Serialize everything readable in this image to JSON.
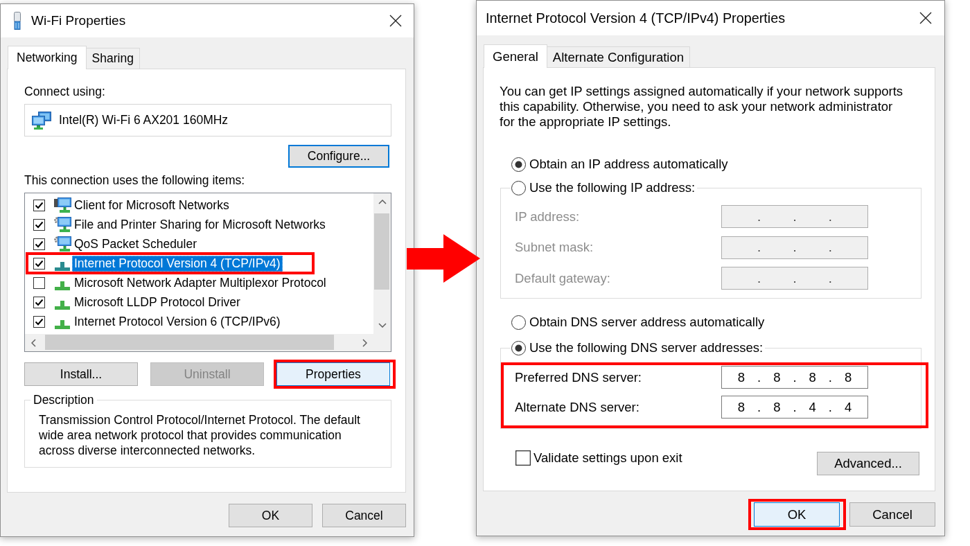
{
  "wifi_properties": {
    "title": "Wi-Fi Properties",
    "tabs": [
      {
        "label": "Networking",
        "selected": true
      },
      {
        "label": "Sharing",
        "selected": false
      }
    ],
    "connect_using_label": "Connect using:",
    "adapter": "Intel(R) Wi-Fi 6 AX201 160MHz",
    "configure_button": {
      "label": "Configure...",
      "focused": true
    },
    "items_label": "This connection uses the following items:",
    "items": [
      {
        "kind": "client",
        "label": "Client for Microsoft Networks",
        "checked": true,
        "selected": false,
        "highlighted": false
      },
      {
        "kind": "service",
        "label": "File and Printer Sharing for Microsoft Networks",
        "checked": true,
        "selected": false,
        "highlighted": false
      },
      {
        "kind": "service",
        "label": "QoS Packet Scheduler",
        "checked": true,
        "selected": false,
        "highlighted": false
      },
      {
        "kind": "protocol",
        "label": "Internet Protocol Version 4 (TCP/IPv4)",
        "checked": true,
        "selected": true,
        "highlighted": true
      },
      {
        "kind": "protocol",
        "label": "Microsoft Network Adapter Multiplexor Protocol",
        "checked": false,
        "selected": false,
        "highlighted": false
      },
      {
        "kind": "protocol",
        "label": "Microsoft LLDP Protocol Driver",
        "checked": true,
        "selected": false,
        "highlighted": false
      },
      {
        "kind": "protocol",
        "label": "Internet Protocol Version 6 (TCP/IPv6)",
        "checked": true,
        "selected": false,
        "highlighted": false
      }
    ],
    "item_buttons": [
      {
        "label": "Install...",
        "disabled": false,
        "hovered": false,
        "highlighted": false
      },
      {
        "label": "Uninstall",
        "disabled": true,
        "hovered": false,
        "highlighted": false
      },
      {
        "label": "Properties",
        "disabled": false,
        "hovered": true,
        "highlighted": true
      }
    ],
    "description": {
      "legend": "Description",
      "text": "Transmission Control Protocol/Internet Protocol. The default wide area network protocol that provides communication across diverse interconnected networks."
    },
    "buttons": [
      {
        "label": "OK",
        "hovered": false,
        "highlighted": false
      },
      {
        "label": "Cancel",
        "hovered": false,
        "highlighted": false
      }
    ]
  },
  "ipv4_properties": {
    "title": "Internet Protocol Version 4 (TCP/IPv4) Properties",
    "tabs": [
      {
        "label": "General",
        "selected": true
      },
      {
        "label": "Alternate Configuration",
        "selected": false
      }
    ],
    "intro": "You can get IP settings assigned automatically if your network supports this capability. Otherwise, you need to ask your network administrator for the appropriate IP settings.",
    "ip": {
      "options": [
        {
          "label": "Obtain an IP address automatically",
          "selected": true
        },
        {
          "label": "Use the following IP address:",
          "selected": false
        }
      ],
      "fields": [
        {
          "label": "IP address:",
          "value": ". . .",
          "disabled": true
        },
        {
          "label": "Subnet mask:",
          "value": ". . .",
          "disabled": true
        },
        {
          "label": "Default gateway:",
          "value": ". . .",
          "disabled": true
        }
      ]
    },
    "dns": {
      "options": [
        {
          "label": "Obtain DNS server address automatically",
          "selected": false
        },
        {
          "label": "Use the following DNS server addresses:",
          "selected": true
        }
      ],
      "highlighted": true,
      "fields": [
        {
          "label": "Preferred DNS server:",
          "value": "8 . 8 . 8 . 8",
          "disabled": false
        },
        {
          "label": "Alternate DNS server:",
          "value": "8 . 8 . 4 . 4",
          "disabled": false
        }
      ]
    },
    "validate_checkbox": {
      "label": "Validate settings upon exit",
      "checked": false
    },
    "advanced_button": {
      "label": "Advanced..."
    },
    "buttons": [
      {
        "label": "OK",
        "hovered": true,
        "highlighted": true
      },
      {
        "label": "Cancel",
        "hovered": false,
        "highlighted": false
      }
    ]
  }
}
